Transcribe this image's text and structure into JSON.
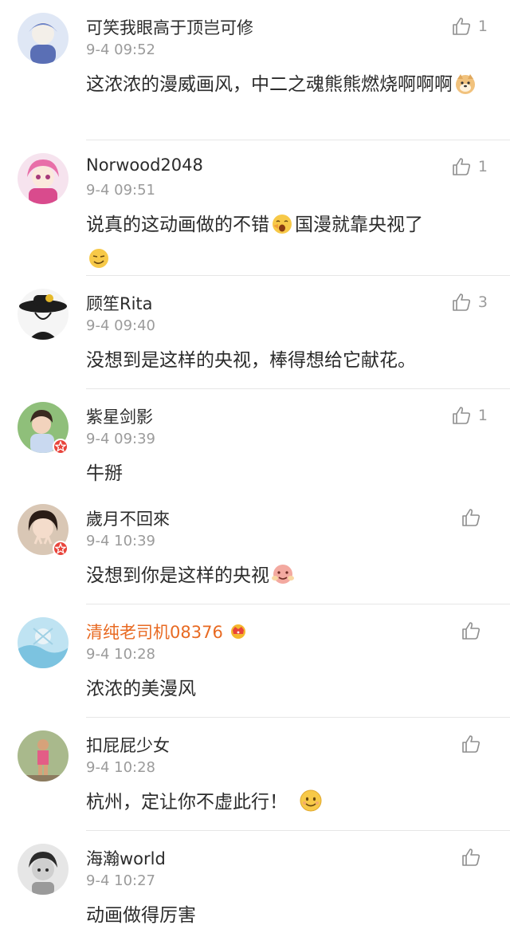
{
  "comments": [
    {
      "name": "可笑我眼高于顶岂可修",
      "time": "9-4 09:52",
      "text": "这浓浓的漫威画风，中二之魂熊熊燃烧啊啊啊",
      "likes": "1"
    },
    {
      "name": "Norwood2048",
      "time": "9-4 09:51",
      "text_a": "说真的这动画做的不错",
      "text_b": "国漫就靠央视了",
      "likes": "1"
    },
    {
      "name": "顾笙Rita",
      "time": "9-4 09:40",
      "text": "没想到是这样的央视，棒得想给它献花。",
      "likes": "3"
    },
    {
      "name": "紫星剑影",
      "time": "9-4 09:39",
      "text": "牛掰",
      "likes": "1"
    },
    {
      "name": "歲月不回來",
      "time": "9-4 10:39",
      "text": "没想到你是这样的央视",
      "likes": ""
    },
    {
      "name": "清纯老司机08376",
      "time": "9-4 10:28",
      "text": "浓浓的美漫风",
      "likes": ""
    },
    {
      "name": "扣屁屁少女",
      "time": "9-4 10:28",
      "text": "杭州，定让你不虚此行！",
      "likes": ""
    },
    {
      "name": "海瀚world",
      "time": "9-4 10:27",
      "text": "动画做得厉害",
      "likes": ""
    }
  ],
  "icons": {
    "like": "thumbs-up-icon",
    "badge": "verified-star-badge-icon",
    "vip": "crown-icon"
  },
  "colors": {
    "vip_name": "#e86a22",
    "badge": "#e8443b",
    "time": "#9b9b9b"
  }
}
